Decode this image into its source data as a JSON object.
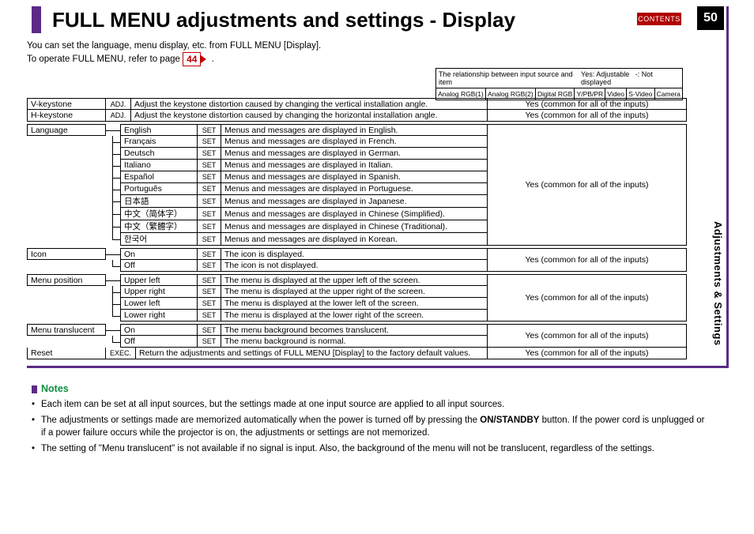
{
  "page": {
    "title": "FULL MENU adjustments and settings - Display",
    "contents_label": "CONTENTS",
    "number": "50",
    "side_tab": "Adjustments & Settings",
    "intro_line1": "You can set the language, menu display, etc. from FULL MENU [Display].",
    "intro_line2a": "To operate FULL MENU, refer to page ",
    "intro_page_ref": "44",
    "intro_line2b": "."
  },
  "legend": {
    "caption": "The relationship between input source and item",
    "yes_label": "Yes: Adjustable",
    "dash_label": "-: Not displayed",
    "sources": [
      "Analog RGB(1)",
      "Analog RGB(2)",
      "Digital RGB",
      "Y/PB/PR",
      "Video",
      "S-Video",
      "Camera"
    ]
  },
  "common": "Yes (common for all of the inputs)",
  "items": {
    "v_keystone": {
      "name": "V-keystone",
      "tag": "ADJ.",
      "desc": "Adjust the keystone distortion caused by changing the vertical installation angle."
    },
    "h_keystone": {
      "name": "H-keystone",
      "tag": "ADJ.",
      "desc": "Adjust the keystone distortion caused by changing the horizontal installation angle."
    },
    "language": {
      "name": "Language",
      "options": [
        {
          "label": "English",
          "tag": "SET",
          "desc": "Menus and messages are displayed in English."
        },
        {
          "label": "Français",
          "tag": "SET",
          "desc": "Menus and messages are displayed in French."
        },
        {
          "label": "Deutsch",
          "tag": "SET",
          "desc": "Menus and messages are displayed in German."
        },
        {
          "label": "Italiano",
          "tag": "SET",
          "desc": "Menus and messages are displayed in Italian."
        },
        {
          "label": "Español",
          "tag": "SET",
          "desc": "Menus and messages are displayed in Spanish."
        },
        {
          "label": "Português",
          "tag": "SET",
          "desc": "Menus and messages are displayed in Portuguese."
        },
        {
          "label": "日本語",
          "tag": "SET",
          "desc": "Menus and messages are displayed in Japanese."
        },
        {
          "label": "中文（简体字）",
          "tag": "SET",
          "desc": "Menus and messages are displayed in Chinese (Simplified)."
        },
        {
          "label": "中文（繁體字）",
          "tag": "SET",
          "desc": "Menus and messages are displayed in Chinese (Traditional)."
        },
        {
          "label": "한국어",
          "tag": "SET",
          "desc": "Menus and messages are displayed in Korean."
        }
      ]
    },
    "icon": {
      "name": "Icon",
      "options": [
        {
          "label": "On",
          "tag": "SET",
          "desc": "The icon is displayed."
        },
        {
          "label": "Off",
          "tag": "SET",
          "desc": "The icon is not displayed."
        }
      ]
    },
    "menu_position": {
      "name": "Menu position",
      "options": [
        {
          "label": "Upper left",
          "tag": "SET",
          "desc": "The menu is displayed at the upper left of the screen."
        },
        {
          "label": "Upper right",
          "tag": "SET",
          "desc": "The menu is displayed at the upper right of the screen."
        },
        {
          "label": "Lower left",
          "tag": "SET",
          "desc": "The menu is displayed at the lower left of the screen."
        },
        {
          "label": "Lower right",
          "tag": "SET",
          "desc": "The menu is displayed at the lower right of the screen."
        }
      ]
    },
    "menu_translucent": {
      "name": "Menu translucent",
      "options": [
        {
          "label": "On",
          "tag": "SET",
          "desc": "The menu background becomes translucent."
        },
        {
          "label": "Off",
          "tag": "SET",
          "desc": "The menu background is normal."
        }
      ]
    },
    "reset": {
      "name": "Reset",
      "tag": "EXEC.",
      "desc": "Return the adjustments and settings of FULL MENU [Display] to the factory default values."
    }
  },
  "notes": {
    "heading": "Notes",
    "b1": "Each item can be set at all input sources, but the settings made at one input source are applied to all input sources.",
    "b2a": "The adjustments or settings made are memorized automatically when the power is turned off by pressing the ",
    "b2_bold": "ON/STANDBY",
    "b2b": " button. If the power cord is unplugged or if a power failure occurs while the projector is on, the adjustments or settings are not memorized.",
    "b3": "The setting of \"Menu translucent\" is not available if no signal is input. Also, the background of the menu will not be translucent, regardless of the settings."
  }
}
